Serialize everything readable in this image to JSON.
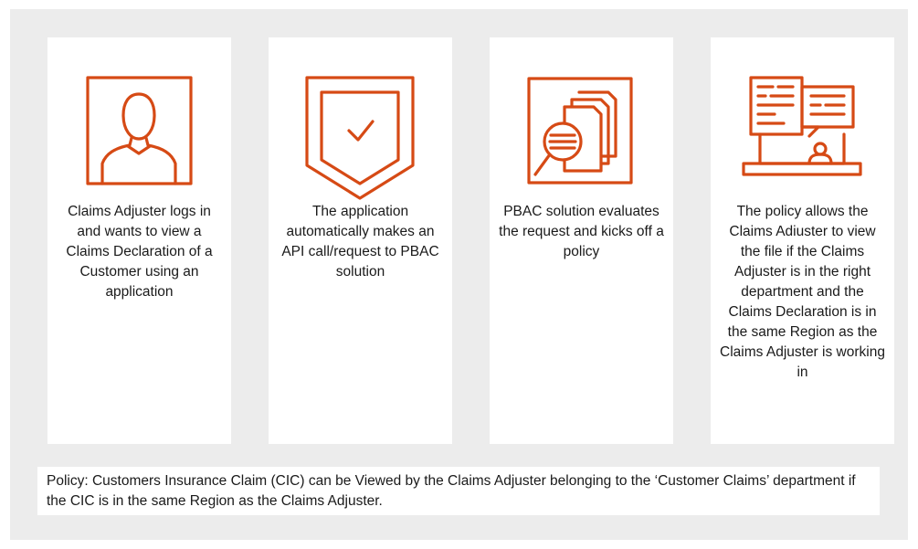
{
  "accent_color": "#d64a15",
  "cards": [
    {
      "icon": "user-profile-icon",
      "text": "Claims Adjuster logs in and wants to view a Claims Declaration of a Customer using an application"
    },
    {
      "icon": "shield-check-icon",
      "text": "The application automatically makes an API call/request to PBAC solution"
    },
    {
      "icon": "document-magnifier-icon",
      "text": "PBAC solution evaluates the request and kicks off a policy"
    },
    {
      "icon": "laptop-document-user-icon",
      "text": "The policy allows the Claims Adiuster to view the file if the Claims Adjuster is in the right department and the Claims Declaration is in the same Region as the Claims Adjuster is working in"
    }
  ],
  "policy_text": "Policy: Customers Insurance Claim (CIC) can be Viewed by the Claims Adjuster belonging to the ‘Customer Claims’ department if the CIC is in the same Region as the Claims Adjuster."
}
